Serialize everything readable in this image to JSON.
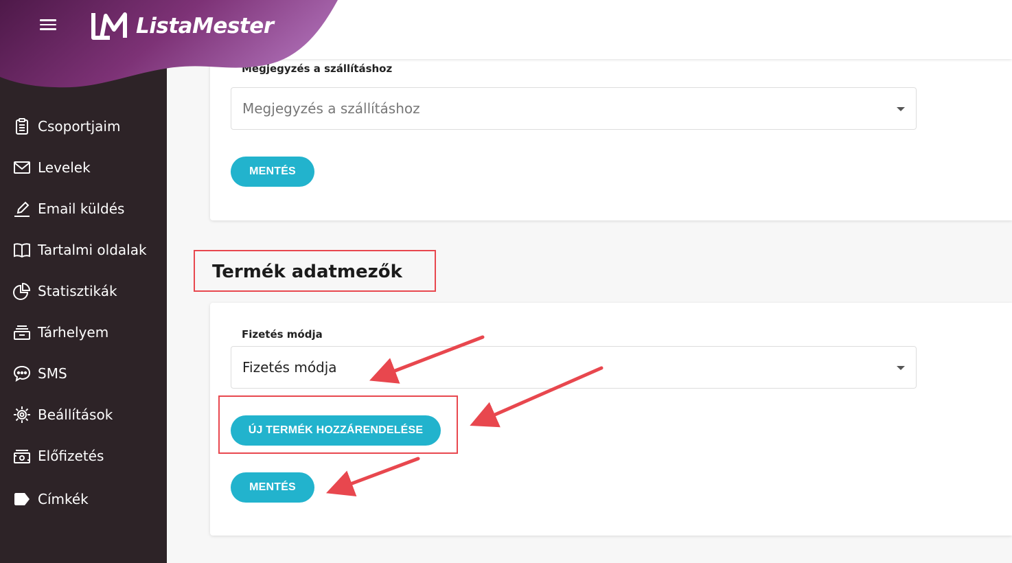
{
  "brand": {
    "name": "ListaMester",
    "gradient_start": "#5b1e55",
    "gradient_end": "#a05fa8"
  },
  "sidebar": {
    "items": [
      {
        "label": "Csoportjaim",
        "icon": "clipboard-icon"
      },
      {
        "label": "Levelek",
        "icon": "envelope-icon"
      },
      {
        "label": "Email küldés",
        "icon": "pencil-icon"
      },
      {
        "label": "Tartalmi oldalak",
        "icon": "book-icon"
      },
      {
        "label": "Statisztikák",
        "icon": "pie-chart-icon"
      },
      {
        "label": "Tárhelyem",
        "icon": "storage-icon"
      },
      {
        "label": "SMS",
        "icon": "chat-bubble-icon"
      },
      {
        "label": "Beállítások",
        "icon": "gear-icon"
      },
      {
        "label": "Előfizetés",
        "icon": "cash-icon"
      },
      {
        "label": "Címkék",
        "icon": "tag-icon"
      }
    ]
  },
  "shipping_section": {
    "field_label": "Megjegyzés a szállításhoz",
    "select_placeholder": "Megjegyzés a szállításhoz",
    "save_label": "MENTÉS"
  },
  "product_section": {
    "title": "Termék adatmezők",
    "field_label": "Fizetés módja",
    "select_value": "Fizetés módja",
    "assign_label": "ÚJ TERMÉK HOZZÁRENDELÉSE",
    "save_label": "MENTÉS"
  },
  "colors": {
    "accent": "#22b3cd",
    "sidebar_bg": "#2d2327",
    "annotation": "#e8474e"
  }
}
